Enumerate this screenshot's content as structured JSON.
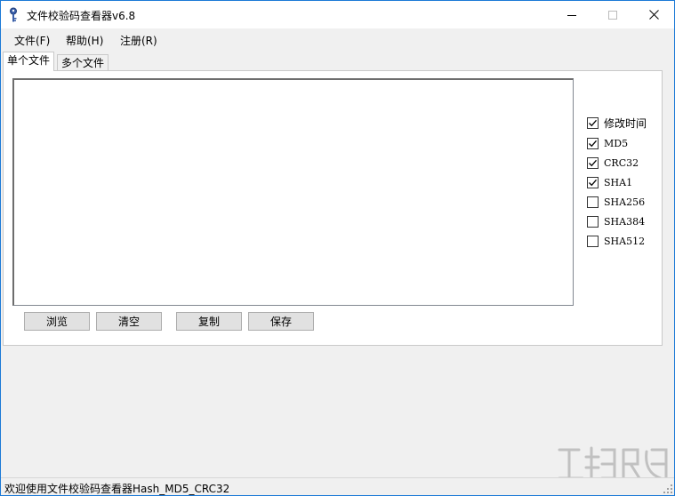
{
  "window": {
    "title": "文件校验码查看器v6.8"
  },
  "menu": [
    {
      "label": "文件(F)"
    },
    {
      "label": "帮助(H)"
    },
    {
      "label": "注册(R)"
    }
  ],
  "tabs": [
    {
      "label": "单个文件",
      "active": true
    },
    {
      "label": "多个文件",
      "active": false
    }
  ],
  "result_box": {
    "value": ""
  },
  "buttons": {
    "browse": "浏览",
    "clear": "清空",
    "copy": "复制",
    "save": "保存"
  },
  "options": [
    {
      "label": "修改时间",
      "checked": true
    },
    {
      "label": "MD5",
      "checked": true
    },
    {
      "label": "CRC32",
      "checked": true
    },
    {
      "label": "SHA1",
      "checked": true
    },
    {
      "label": "SHA256",
      "checked": false
    },
    {
      "label": "SHA384",
      "checked": false
    },
    {
      "label": "SHA512",
      "checked": false
    }
  ],
  "status": {
    "text": "欢迎使用文件校验码查看器Hash_MD5_CRC32"
  },
  "colors": {
    "window_border": "#1c7ad6",
    "chrome": "#f0f0f0",
    "button_face": "#e1e1e1"
  }
}
